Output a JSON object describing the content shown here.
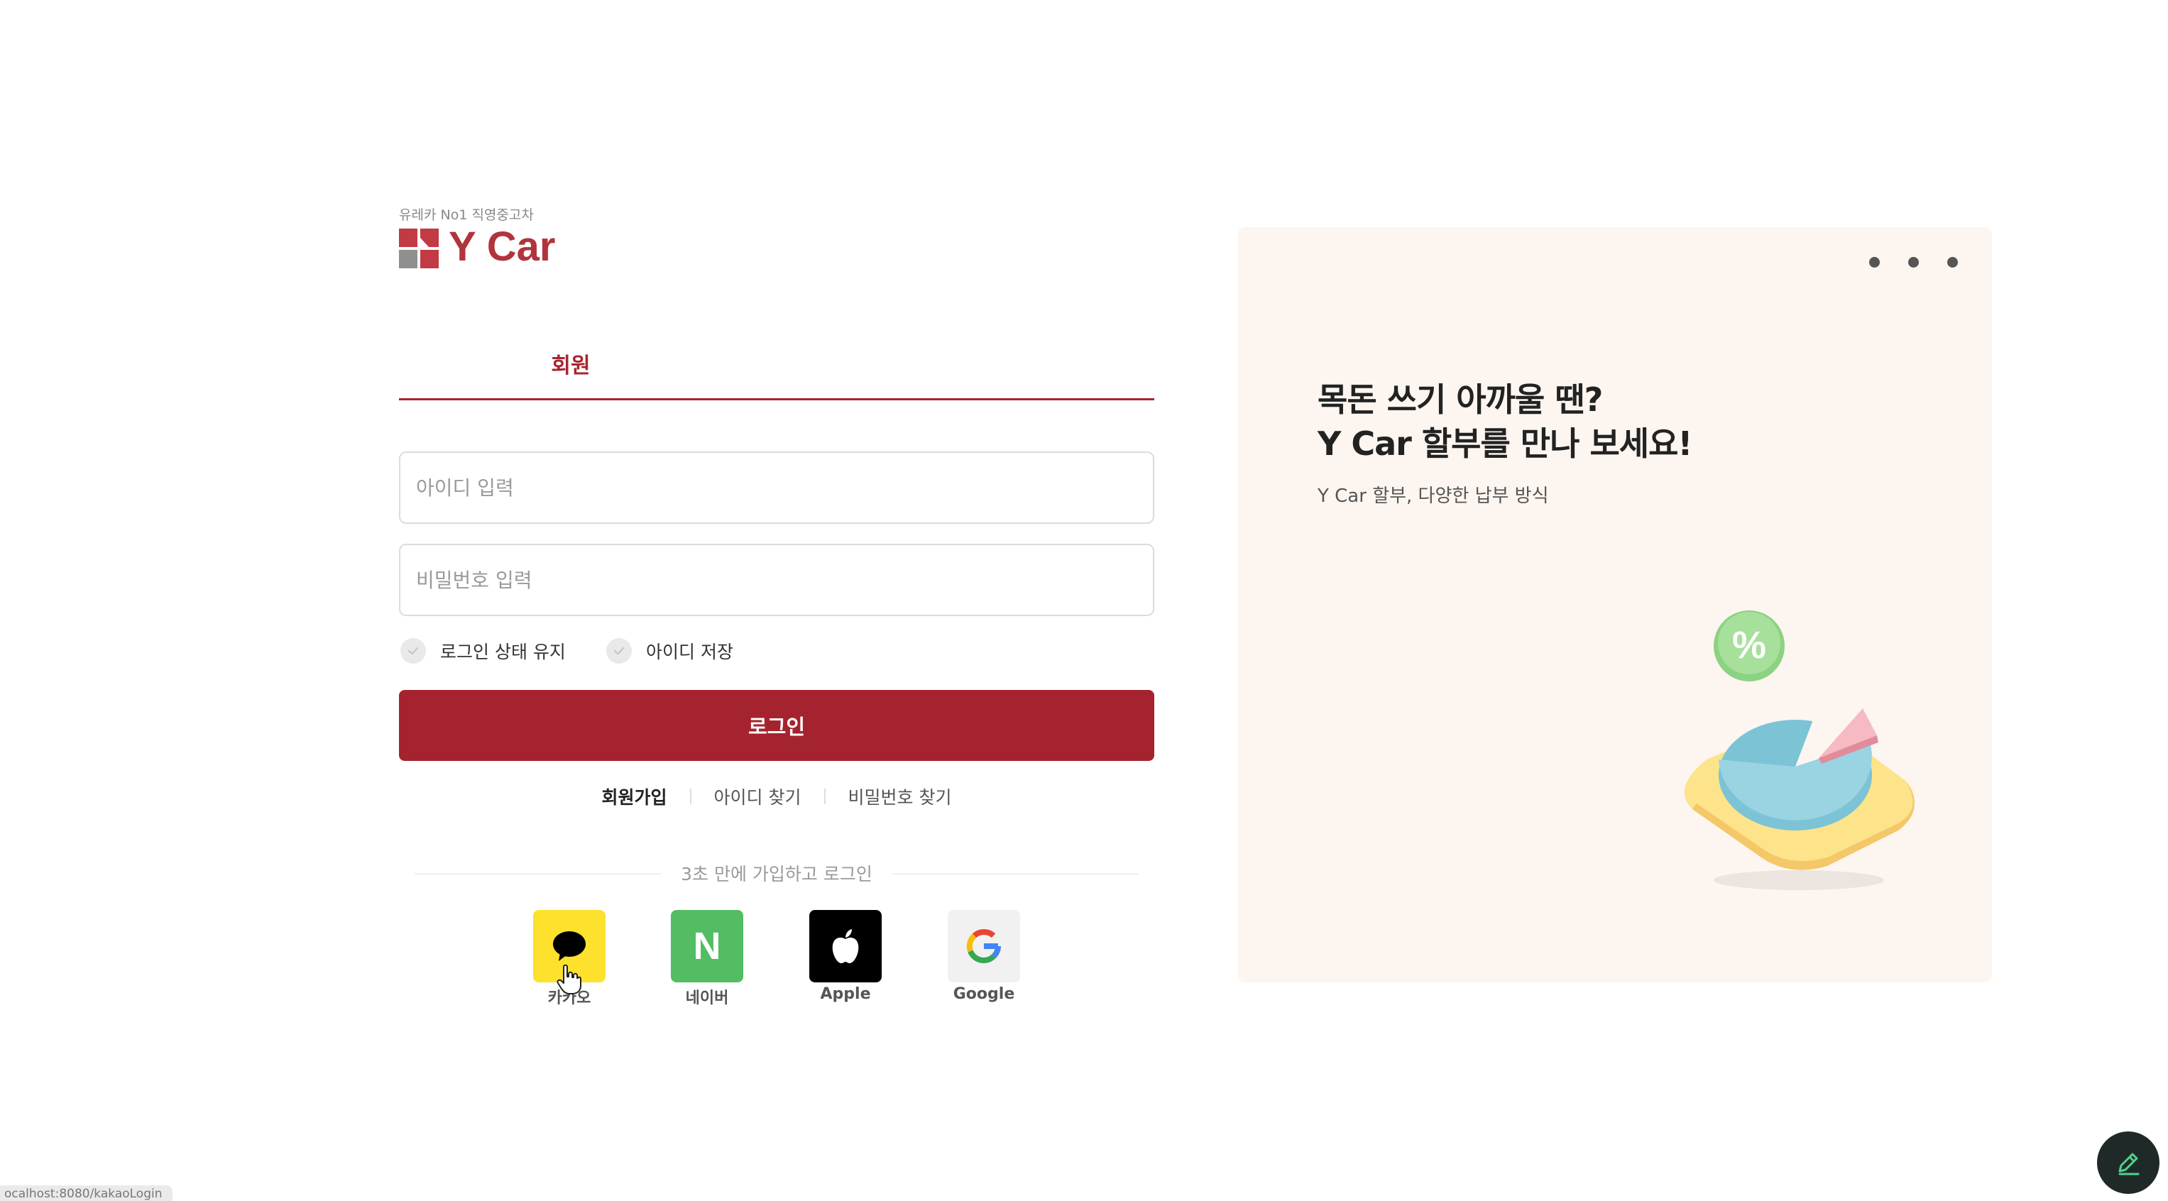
{
  "logo": {
    "tagline": "유레카 No1 직영중고차",
    "name": "Y Car"
  },
  "tabs": {
    "member_label": "회원"
  },
  "form": {
    "id_placeholder": "아이디 입력",
    "password_placeholder": "비밀번호 입력",
    "keep_login_label": "로그인 상태 유지",
    "save_id_label": "아이디 저장",
    "login_button_label": "로그인"
  },
  "links": {
    "signup": "회원가입",
    "find_id": "아이디 찾기",
    "find_password": "비밀번호 찾기"
  },
  "social": {
    "caption": "3초 만에 가입하고 로그인",
    "kakao": "카카오",
    "naver": "네이버",
    "naver_mark": "N",
    "apple": "Apple",
    "google": "Google",
    "google_mark": "G"
  },
  "banner": {
    "title_line1": "목돈 쓰기 아까울 땐?",
    "title_line2": "Y Car 할부를 만나 보세요!",
    "subtitle": "Y Car 할부, 다양한 납부 방식",
    "illustration_badge": "%"
  },
  "status_bar": {
    "url": "ocalhost:8080/kakaoLogin"
  },
  "colors": {
    "brand": "#a5232e",
    "kakao": "#fde12c",
    "naver": "#52bd62",
    "apple": "#000000",
    "banner_bg": "#fdf5f0"
  }
}
